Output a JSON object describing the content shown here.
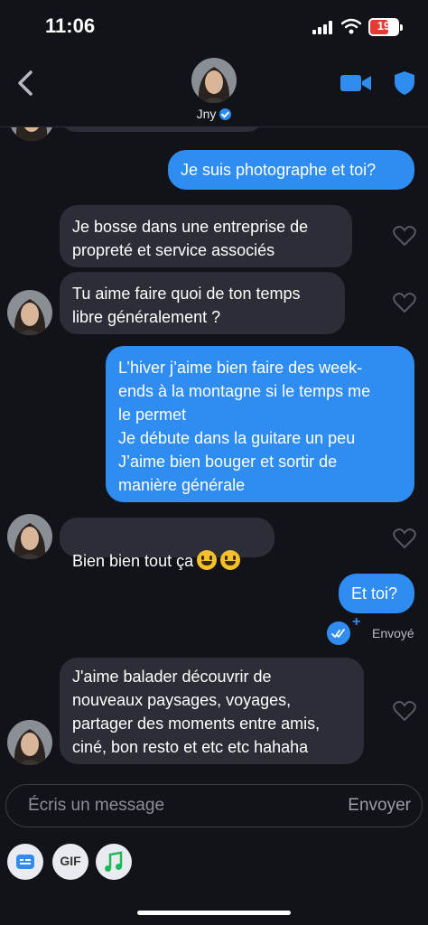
{
  "status_bar": {
    "time": "11:06",
    "battery": "19"
  },
  "header": {
    "contact_name": "Jny"
  },
  "messages": [
    {
      "dir": "out",
      "text": "Je suis photographe et toi?"
    },
    {
      "dir": "in",
      "text": "Je bosse dans une entreprise de\npropreté et service associés"
    },
    {
      "dir": "in",
      "text": "Tu aime faire quoi de ton temps\nlibre généralement ?"
    },
    {
      "dir": "out",
      "text": "L’hiver j’aime bien faire des week-\nends à la montagne si le temps me\nle permet\nJe débute dans la guitare un peu\nJ’aime bien bouger et sortir de\nmanière générale"
    },
    {
      "dir": "in",
      "text": "Bien bien tout ça"
    },
    {
      "dir": "out",
      "text": "Et toi?"
    },
    {
      "dir": "in",
      "text": "J'aime balader découvrir de\nnouveaux paysages, voyages,\npartager des moments entre amis,\nciné, bon resto et etc etc hahaha"
    }
  ],
  "sent_status": "Envoyé",
  "composer": {
    "placeholder": "Écris un message",
    "send_label": "Envoyer"
  },
  "toolbar": {
    "gif_label": "GIF"
  },
  "colors": {
    "accent": "#2f8cf0",
    "background": "#111318",
    "incoming_bubble": "#2b2e36"
  },
  "icons": [
    "back-icon",
    "video-call-icon",
    "shield-icon",
    "heart-icon",
    "sent-check-icon",
    "sticker-icon",
    "music-icon"
  ]
}
